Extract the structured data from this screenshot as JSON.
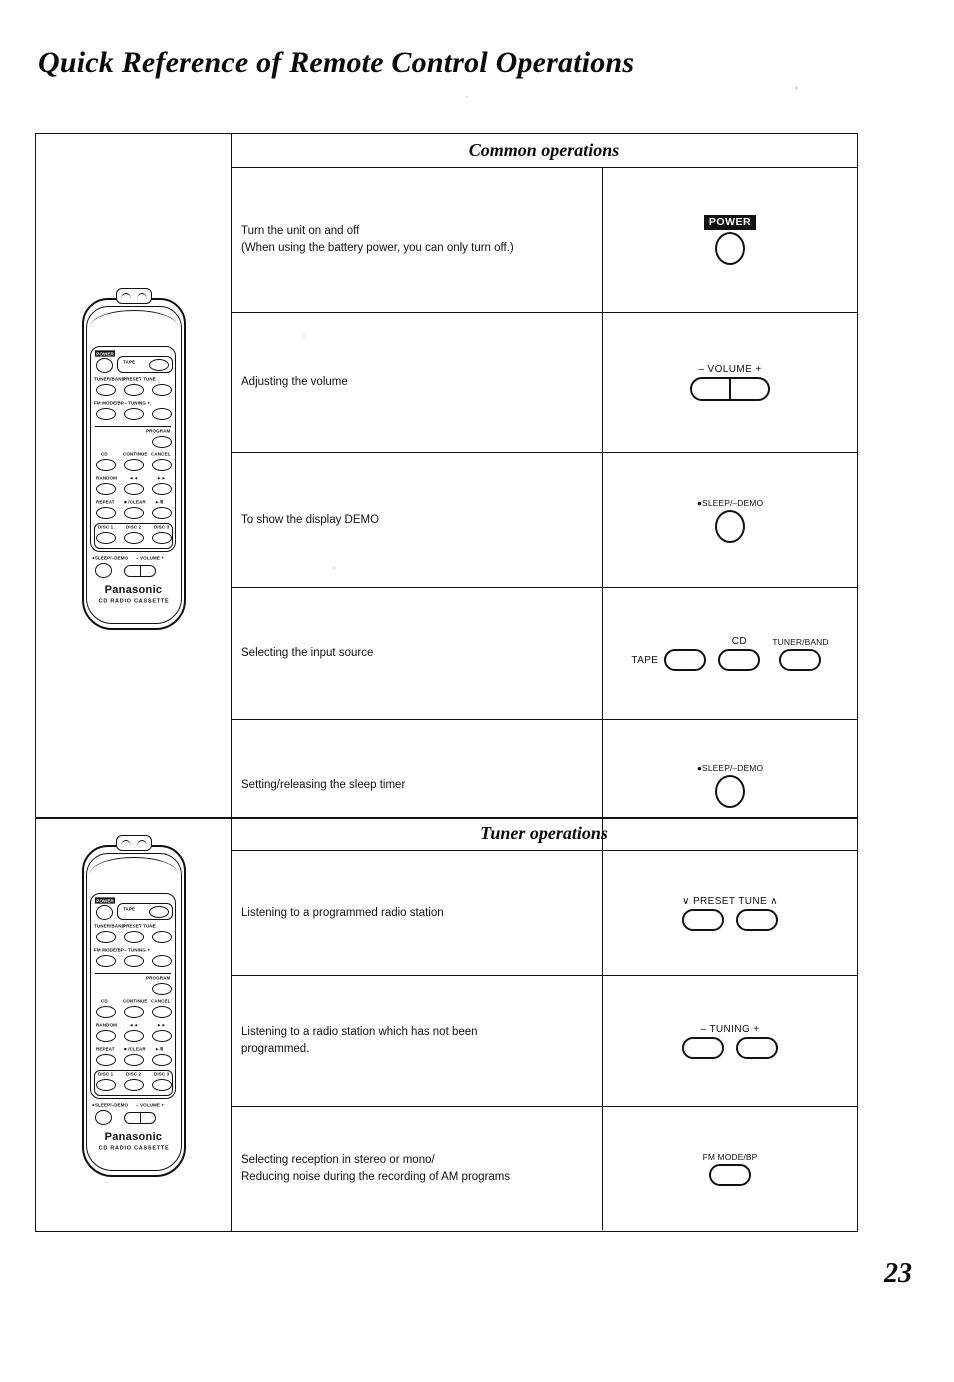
{
  "page": {
    "title": "Quick Reference of Remote Control Operations",
    "number": "23"
  },
  "sections": [
    {
      "heading": "Common operations",
      "rows": [
        {
          "description_lines": [
            "Turn the unit on and off",
            "(When using the battery power, you can only turn off.)"
          ],
          "control": {
            "kind": "round",
            "label": "POWER",
            "label_style": "inverted"
          }
        },
        {
          "description_lines": [
            "Adjusting the volume"
          ],
          "control": {
            "kind": "rocker",
            "label": "– VOLUME +"
          }
        },
        {
          "description_lines": [
            "To show the display DEMO"
          ],
          "control": {
            "kind": "round",
            "label": "●SLEEP/–DEMO",
            "label_style": "small"
          }
        },
        {
          "description_lines": [
            "Selecting the input source"
          ],
          "control": {
            "kind": "source-group",
            "buttons": [
              {
                "label": "TAPE",
                "position": "left"
              },
              {
                "label": "CD",
                "position": "above"
              },
              {
                "label": "TUNER/BAND",
                "position": "above"
              }
            ]
          }
        },
        {
          "description_lines": [
            "Setting/releasing the sleep timer"
          ],
          "control": {
            "kind": "round",
            "label": "●SLEEP/–DEMO",
            "label_style": "small"
          }
        }
      ]
    },
    {
      "heading": "Tuner operations",
      "rows": [
        {
          "description_lines": [
            "Listening to a programmed radio station"
          ],
          "control": {
            "kind": "pill-pair",
            "label": "∨ PRESET TUNE ∧"
          }
        },
        {
          "description_lines": [
            "Listening to a radio station which has not been",
            "programmed."
          ],
          "control": {
            "kind": "pill-pair",
            "label": "– TUNING +"
          }
        },
        {
          "description_lines": [
            "Selecting reception in stereo or mono/",
            "Reducing noise during the recording of AM programs"
          ],
          "control": {
            "kind": "pill-single",
            "label": "FM MODE/BP"
          }
        }
      ]
    }
  ],
  "remote": {
    "brand": "Panasonic",
    "brand_subtitle": "CD RADIO CASSETTE",
    "keys": [
      {
        "label": "POWER",
        "style": "inverted"
      },
      {
        "label": "TAPE"
      },
      {
        "label": "TUNER/BAND"
      },
      {
        "label": "PRESET TUNE"
      },
      {
        "label": "FM MODE/BP"
      },
      {
        "label": "– TUNING +"
      },
      {
        "label": "PROGRAM"
      },
      {
        "label": "CD"
      },
      {
        "label": "CONTINUE"
      },
      {
        "label": "CANCEL"
      },
      {
        "label": "RANDOM"
      },
      {
        "label": "◄◄"
      },
      {
        "label": "►►"
      },
      {
        "label": "REPEAT"
      },
      {
        "label": "■ /CLEAR"
      },
      {
        "label": "►/Ⅱ"
      },
      {
        "label": "DISC 1"
      },
      {
        "label": "DISC 2"
      },
      {
        "label": "DISC 3"
      },
      {
        "label": "●SLEEP/–DEMO"
      },
      {
        "label": "– VOLUME +"
      }
    ]
  }
}
